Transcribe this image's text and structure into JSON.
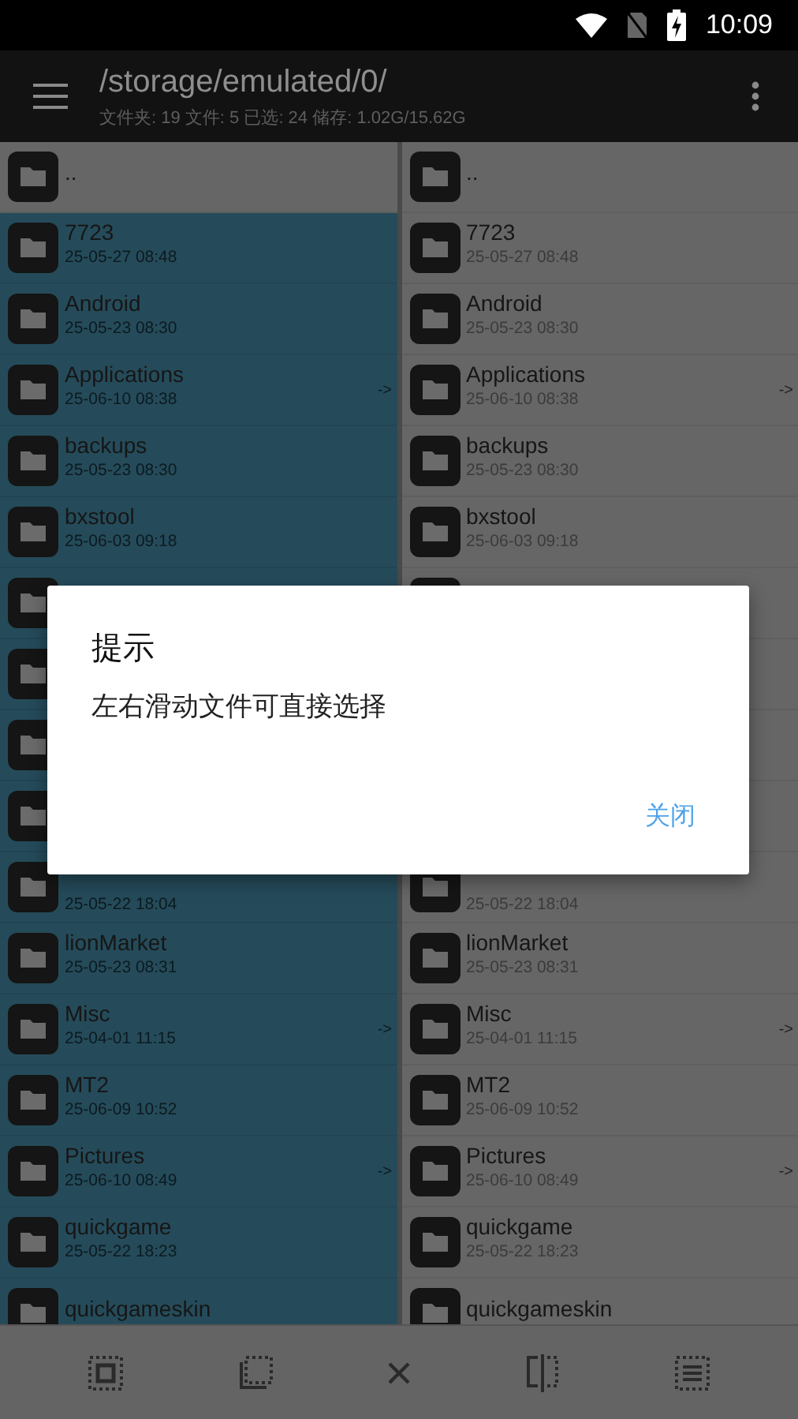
{
  "status_bar": {
    "time": "10:09"
  },
  "toolbar": {
    "title": "/storage/emulated/0/",
    "subtitle": "文件夹: 19  文件: 5  已选: 24  储存: 1.02G/15.62G"
  },
  "panes": [
    {
      "items": [
        {
          "name": "..",
          "selected": false
        },
        {
          "name": "7723",
          "date": "25-05-27 08:48",
          "selected": true
        },
        {
          "name": "Android",
          "date": "25-05-23 08:30",
          "selected": true
        },
        {
          "name": "Applications",
          "date": "25-06-10 08:38",
          "arrow": "->",
          "selected": true
        },
        {
          "name": "backups",
          "date": "25-05-23 08:30",
          "selected": true
        },
        {
          "name": "bxstool",
          "date": "25-06-03 09:18",
          "selected": true
        },
        {
          "selected": true
        },
        {
          "selected": true
        },
        {
          "selected": true
        },
        {
          "selected": true
        },
        {
          "date": "25-05-22 18:04",
          "selected": true
        },
        {
          "name": "lionMarket",
          "date": "25-05-23 08:31",
          "selected": true
        },
        {
          "name": "Misc",
          "date": "25-04-01 11:15",
          "arrow": "->",
          "selected": true
        },
        {
          "name": "MT2",
          "date": "25-06-09 10:52",
          "selected": true
        },
        {
          "name": "Pictures",
          "date": "25-06-10 08:49",
          "arrow": "->",
          "selected": true
        },
        {
          "name": "quickgame",
          "date": "25-05-22 18:23",
          "selected": true
        },
        {
          "name": "quickgameskin",
          "selected": true
        }
      ]
    },
    {
      "items": [
        {
          "name": "..",
          "selected": false
        },
        {
          "name": "7723",
          "date": "25-05-27 08:48",
          "selected": false
        },
        {
          "name": "Android",
          "date": "25-05-23 08:30",
          "selected": false
        },
        {
          "name": "Applications",
          "date": "25-06-10 08:38",
          "arrow": "->",
          "selected": false
        },
        {
          "name": "backups",
          "date": "25-05-23 08:30",
          "selected": false
        },
        {
          "name": "bxstool",
          "date": "25-06-03 09:18",
          "selected": false
        },
        {
          "selected": false
        },
        {
          "selected": false
        },
        {
          "selected": false
        },
        {
          "selected": false
        },
        {
          "date": "25-05-22 18:04",
          "selected": false
        },
        {
          "name": "lionMarket",
          "date": "25-05-23 08:31",
          "selected": false
        },
        {
          "name": "Misc",
          "date": "25-04-01 11:15",
          "arrow": "->",
          "selected": false
        },
        {
          "name": "MT2",
          "date": "25-06-09 10:52",
          "selected": false
        },
        {
          "name": "Pictures",
          "date": "25-06-10 08:49",
          "arrow": "->",
          "selected": false
        },
        {
          "name": "quickgame",
          "date": "25-05-22 18:23",
          "selected": false
        },
        {
          "name": "quickgameskin",
          "selected": false
        }
      ]
    }
  ],
  "dialog": {
    "title": "提示",
    "message": "左右滑动文件可直接选择",
    "button": "关闭"
  }
}
